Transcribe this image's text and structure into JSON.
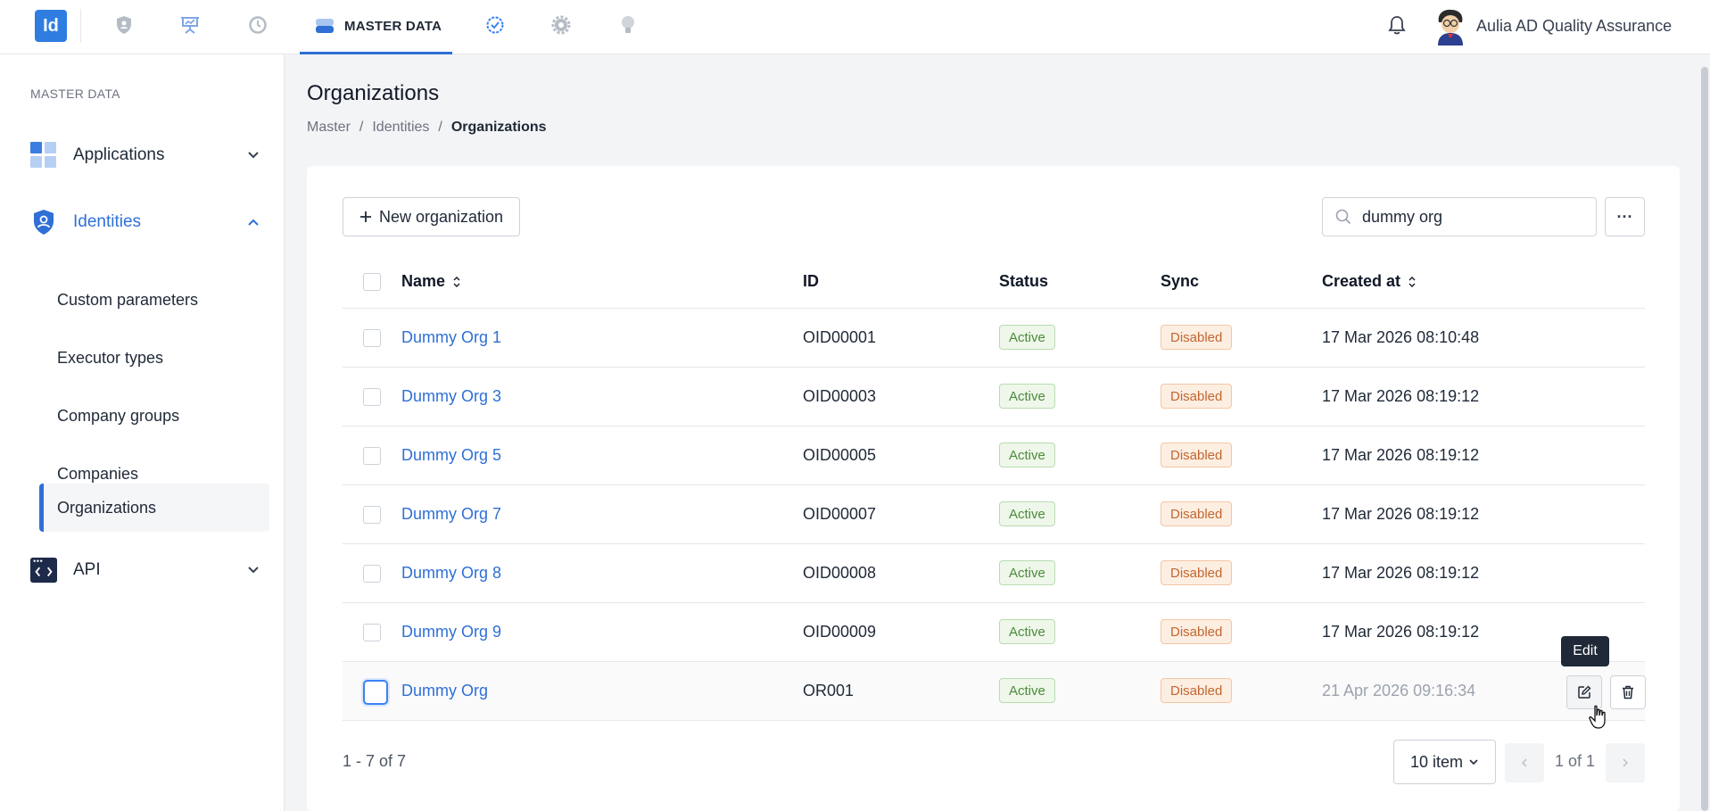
{
  "app": {
    "logo_text": "Id",
    "user_name": "Aulia AD Quality Assurance"
  },
  "nav": {
    "active_label": "MASTER DATA"
  },
  "sidebar": {
    "section_title": "MASTER DATA",
    "groups": [
      {
        "label": "Applications"
      },
      {
        "label": "Identities"
      },
      {
        "label": "API"
      }
    ],
    "sub_items": [
      {
        "label": "Custom parameters"
      },
      {
        "label": "Executor types"
      },
      {
        "label": "Company groups"
      },
      {
        "label": "Companies"
      },
      {
        "label": "Organizations"
      }
    ]
  },
  "page": {
    "title": "Organizations",
    "breadcrumb": [
      "Master",
      "Identities",
      "Organizations"
    ]
  },
  "toolbar": {
    "new_label": "New organization",
    "search_value": "dummy org",
    "more_label": "···"
  },
  "table": {
    "columns": [
      "Name",
      "ID",
      "Status",
      "Sync",
      "Created at"
    ],
    "rows": [
      {
        "name": "Dummy Org 1",
        "id": "OID00001",
        "status": "Active",
        "sync": "Disabled",
        "created": "17 Mar 2026 08:10:48"
      },
      {
        "name": "Dummy Org 3",
        "id": "OID00003",
        "status": "Active",
        "sync": "Disabled",
        "created": "17 Mar 2026 08:19:12"
      },
      {
        "name": "Dummy Org 5",
        "id": "OID00005",
        "status": "Active",
        "sync": "Disabled",
        "created": "17 Mar 2026 08:19:12"
      },
      {
        "name": "Dummy Org 7",
        "id": "OID00007",
        "status": "Active",
        "sync": "Disabled",
        "created": "17 Mar 2026 08:19:12"
      },
      {
        "name": "Dummy Org 8",
        "id": "OID00008",
        "status": "Active",
        "sync": "Disabled",
        "created": "17 Mar 2026 08:19:12"
      },
      {
        "name": "Dummy Org 9",
        "id": "OID00009",
        "status": "Active",
        "sync": "Disabled",
        "created": "17 Mar 2026 08:19:12"
      },
      {
        "name": "Dummy Org",
        "id": "OR001",
        "status": "Active",
        "sync": "Disabled",
        "created": "21 Apr 2026 09:16:34"
      }
    ],
    "tooltip": "Edit"
  },
  "pagination": {
    "range": "1 - 7 of 7",
    "page_size": "10 item",
    "page_info": "1 of 1"
  },
  "colors": {
    "accent": "#2f6fd6",
    "logo": "#2f7de1"
  }
}
